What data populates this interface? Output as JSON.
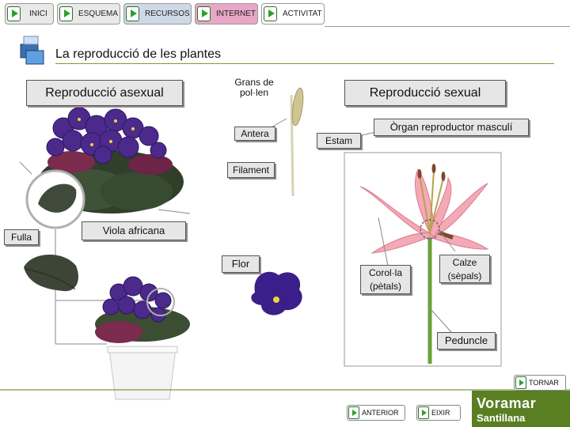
{
  "nav": {
    "inici": "INICI",
    "esquema": "ESQUEMA",
    "recursos": "RECURSOS",
    "internet": "INTERNET",
    "activitat": "ACTIVITAT"
  },
  "page_title": "La reproducció de les plantes",
  "labels": {
    "asexual": "Reproducció asexual",
    "sexual": "Reproducció sexual",
    "grans_pollen": "Grans de pol·len",
    "antera": "Antera",
    "estam": "Estam",
    "organ_masculi": "Òrgan reproductor masculí",
    "filament": "Filament",
    "fulla": "Fulla",
    "viola": "Viola africana",
    "flor": "Flor",
    "corola": "Corol·la (pètals)",
    "calze": "Calze (sèpals)",
    "peduncle": "Peduncle"
  },
  "buttons": {
    "tornar": "TORNAR",
    "anterior": "ANTERIOR",
    "eixir": "EIXIR"
  },
  "brand": {
    "line1": "Voramar",
    "line2": "Santillana"
  },
  "colors": {
    "brand_green": "#5a7f22",
    "violet": "#4b2a8c",
    "lily_pink": "#f4a9b6",
    "label_bg": "#e6e6e6"
  }
}
